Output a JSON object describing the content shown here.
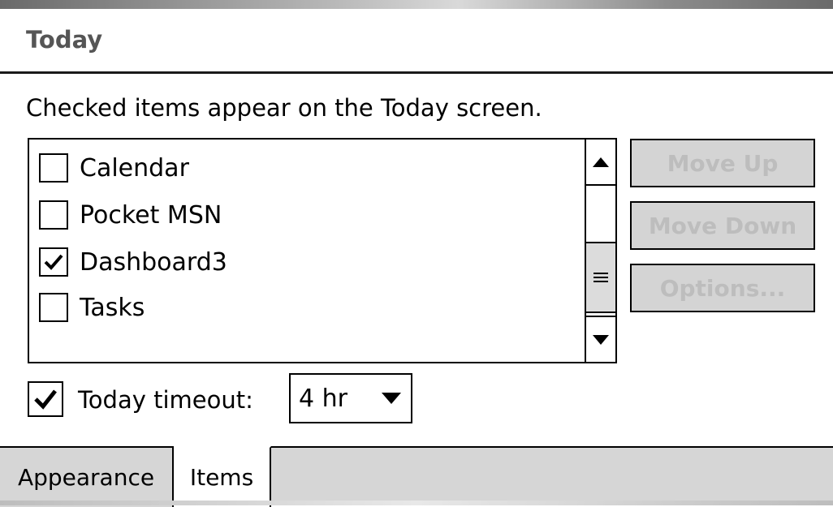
{
  "page": {
    "title": "Today",
    "instruction": "Checked items appear on the Today screen."
  },
  "list": {
    "items": [
      {
        "label": "Calendar",
        "checked": false
      },
      {
        "label": "Pocket MSN",
        "checked": false
      },
      {
        "label": "Dashboard3",
        "checked": true
      },
      {
        "label": "Tasks",
        "checked": false
      }
    ]
  },
  "buttons": {
    "move_up": "Move Up",
    "move_down": "Move Down",
    "options": "Options..."
  },
  "timeout": {
    "label": "Today timeout:",
    "checked": true,
    "value": "4 hr"
  },
  "tabs": [
    {
      "label": "Appearance",
      "active": false
    },
    {
      "label": "Items",
      "active": true
    }
  ],
  "icons": {
    "scroll_up": "arrow-up-icon",
    "scroll_down": "arrow-down-icon",
    "scroll_thumb": "grip-icon",
    "dropdown": "chevron-down-icon",
    "check": "checkmark-icon"
  },
  "colors": {
    "title": "#555555",
    "disabled_button_bg": "#d4d4d4",
    "disabled_button_text": "#bdbdbd",
    "tab_strip": "#d6d6d6"
  }
}
